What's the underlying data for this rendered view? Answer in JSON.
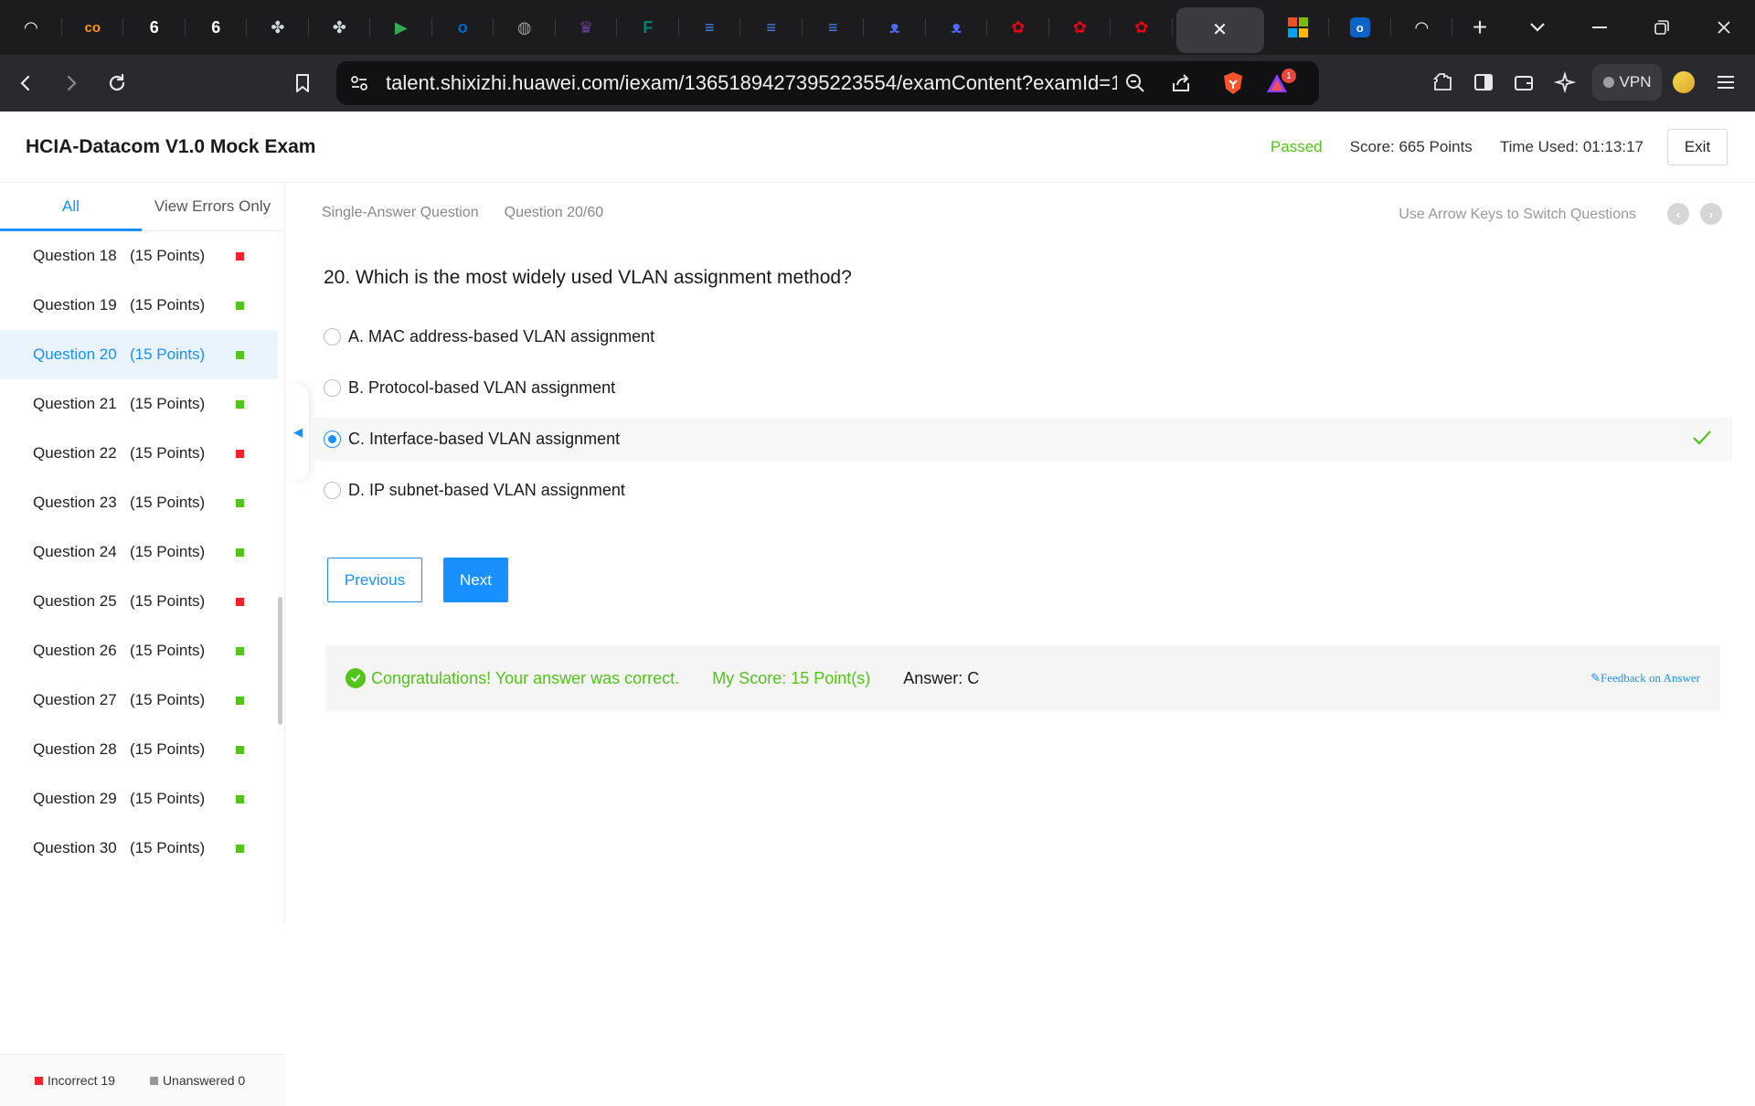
{
  "browser": {
    "tabs": [
      {
        "icon": "speed-icon",
        "color": "#ffffff",
        "glyph": "◠"
      },
      {
        "icon": "coursera-icon",
        "color": "#ff9900",
        "glyph": "co"
      },
      {
        "icon": "six-icon",
        "color": "#ffffff",
        "glyph": "6"
      },
      {
        "icon": "six-icon",
        "color": "#ffffff",
        "glyph": "6"
      },
      {
        "icon": "bee-icon",
        "color": "#cfd8dc",
        "glyph": "✤"
      },
      {
        "icon": "bee-icon",
        "color": "#cfd8dc",
        "glyph": "✤"
      },
      {
        "icon": "meet-icon",
        "color": "#34a853",
        "glyph": "▶"
      },
      {
        "icon": "outlook-icon",
        "color": "#0a64c8",
        "glyph": "o"
      },
      {
        "icon": "globe-icon",
        "color": "#9e9e9e",
        "glyph": "◍"
      },
      {
        "icon": "crest-icon",
        "color": "#6a3d9a",
        "glyph": "♛"
      },
      {
        "icon": "forms-icon",
        "color": "#087f6b",
        "glyph": "F"
      },
      {
        "icon": "docs-icon",
        "color": "#4285f4",
        "glyph": "≡"
      },
      {
        "icon": "docs-icon",
        "color": "#4285f4",
        "glyph": "≡"
      },
      {
        "icon": "docs-icon",
        "color": "#4285f4",
        "glyph": "≡"
      },
      {
        "icon": "deepseek-icon",
        "color": "#4d6bfe",
        "glyph": "ᴥ"
      },
      {
        "icon": "deepseek-icon",
        "color": "#4d6bfe",
        "glyph": "ᴥ"
      },
      {
        "icon": "huawei-icon",
        "color": "#e60012",
        "glyph": "✿"
      },
      {
        "icon": "huawei-icon",
        "color": "#e60012",
        "glyph": "✿"
      },
      {
        "icon": "huawei-icon",
        "color": "#e60012",
        "glyph": "✿"
      }
    ],
    "active_tab_close": "✕",
    "after_tabs": [
      {
        "icon": "microsoft-icon"
      },
      {
        "icon": "outlook-icon"
      },
      {
        "icon": "speed-icon"
      }
    ],
    "new_tab": "+",
    "url": "talent.shixizhi.huawei.com/iexam/1365189427395223554/examContent?examId=1...",
    "vpn_label": "VPN",
    "notification_count": "1"
  },
  "header": {
    "title": "HCIA-Datacom V1.0 Mock Exam",
    "status": "Passed",
    "score": "Score:  665 Points",
    "time_used": "Time Used:  01:13:17",
    "exit_label": "Exit"
  },
  "sidebar": {
    "tabs": [
      "All",
      "View Errors Only"
    ],
    "questions": [
      {
        "name": "Question 18",
        "points": "(15 Points)",
        "status": "incorrect"
      },
      {
        "name": "Question 19",
        "points": "(15 Points)",
        "status": "correct"
      },
      {
        "name": "Question 20",
        "points": "(15 Points)",
        "status": "correct",
        "current": true
      },
      {
        "name": "Question 21",
        "points": "(15 Points)",
        "status": "correct"
      },
      {
        "name": "Question 22",
        "points": "(15 Points)",
        "status": "incorrect"
      },
      {
        "name": "Question 23",
        "points": "(15 Points)",
        "status": "correct"
      },
      {
        "name": "Question 24",
        "points": "(15 Points)",
        "status": "correct"
      },
      {
        "name": "Question 25",
        "points": "(15 Points)",
        "status": "incorrect"
      },
      {
        "name": "Question 26",
        "points": "(15 Points)",
        "status": "correct"
      },
      {
        "name": "Question 27",
        "points": "(15 Points)",
        "status": "correct"
      },
      {
        "name": "Question 28",
        "points": "(15 Points)",
        "status": "correct"
      },
      {
        "name": "Question 29",
        "points": "(15 Points)",
        "status": "correct"
      },
      {
        "name": "Question 30",
        "points": "(15 Points)",
        "status": "correct"
      }
    ],
    "legend": {
      "incorrect": "Incorrect 19",
      "unanswered": "Unanswered 0"
    }
  },
  "colors": {
    "correct": "#52c41a",
    "incorrect": "#f5222d",
    "unanswered": "#999999",
    "accent": "#1890ff"
  },
  "question": {
    "type": "Single-Answer Question",
    "counter": "Question 20/60",
    "switch_hint": "Use Arrow Keys to Switch Questions",
    "text": "20. Which is the most widely used VLAN assignment method?",
    "options": [
      {
        "label": "A. MAC address-based VLAN assignment",
        "selected": false
      },
      {
        "label": "B. Protocol-based VLAN assignment",
        "selected": false
      },
      {
        "label": "C. Interface-based VLAN assignment",
        "selected": true,
        "correct": true
      },
      {
        "label": "D. IP subnet-based VLAN assignment",
        "selected": false
      }
    ],
    "prev_label": "Previous",
    "next_label": "Next"
  },
  "result": {
    "message": "Congratulations! Your answer was correct.",
    "my_score": "My Score:  15 Point(s)",
    "answer": "Answer:  C",
    "feedback": "Feedback on Answer"
  }
}
